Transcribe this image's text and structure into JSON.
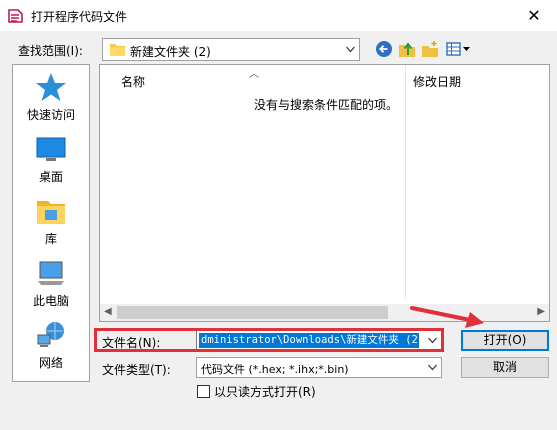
{
  "window": {
    "title": "打开程序代码文件",
    "close_glyph": "✕"
  },
  "lookin": {
    "label": "查找范围(I):",
    "value": "新建文件夹 (2)"
  },
  "places": [
    {
      "label": "快速访问",
      "icon": "star-icon"
    },
    {
      "label": "桌面",
      "icon": "desktop-icon"
    },
    {
      "label": "库",
      "icon": "library-icon"
    },
    {
      "label": "此电脑",
      "icon": "computer-icon"
    },
    {
      "label": "网络",
      "icon": "network-icon"
    }
  ],
  "filelist": {
    "columns": [
      "名称",
      "修改日期"
    ],
    "empty_message": "没有与搜索条件匹配的项。"
  },
  "filename": {
    "label": "文件名(N):",
    "value": "dministrator\\Downloads\\新建文件夹 (2)"
  },
  "filetype": {
    "label": "文件类型(T):",
    "value": "代码文件 (*.hex; *.ihx;*.bin)"
  },
  "readonly_label": "以只读方式打开(R)",
  "buttons": {
    "open": "打开(O)",
    "cancel": "取消"
  },
  "colors": {
    "accent": "#0078d7",
    "annotation": "#e0303a"
  }
}
